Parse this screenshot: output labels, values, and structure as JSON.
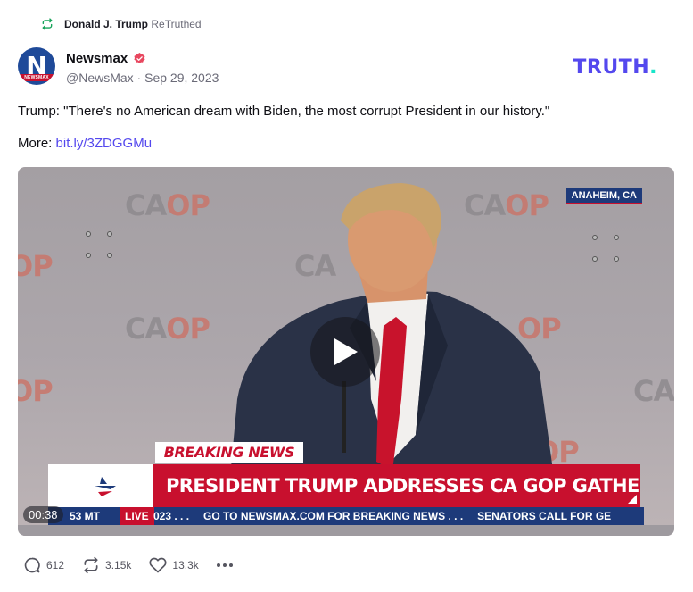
{
  "retruth": {
    "icon": "retruth-icon",
    "name": "Donald J. Trump",
    "suffix": "ReTruthed",
    "color": "#17a35a"
  },
  "author": {
    "avatar_letter": "N",
    "avatar_text": "NEWSMAX",
    "name": "Newsmax",
    "verified_icon": "verified-badge-icon",
    "handle_date": "@NewsMax · Sep 29, 2023"
  },
  "brand": {
    "logo_text": "TRUTH",
    "logo_dot": ".",
    "color": "#5448ee",
    "dot_color": "#17e5c9"
  },
  "post": {
    "text": "Trump: \"There's no American dream with Biden, the most corrupt President in our history.\"",
    "more_label": "More:",
    "link_text": "bit.ly/3ZDGGMu"
  },
  "video": {
    "watermark": "CA",
    "watermark_op": "OP",
    "location": "ANAHEIM, CA",
    "breaking": "BREAKING NEWS",
    "headline": "PRESIDENT TRUMP ADDRESSES CA GOP GATHERING",
    "ticker_time": "53 MT",
    "ticker_live": "LIVE",
    "ticker_year": "023 . . .",
    "ticker_goto": "GO TO NEWSMAX.COM FOR BREAKING NEWS . . .",
    "ticker_senators": "SENATORS CALL FOR GE",
    "duration": "00:38",
    "play_icon": "play-icon"
  },
  "actions": {
    "reply_count": "612",
    "retruth_count": "3.15k",
    "like_count": "13.3k"
  }
}
